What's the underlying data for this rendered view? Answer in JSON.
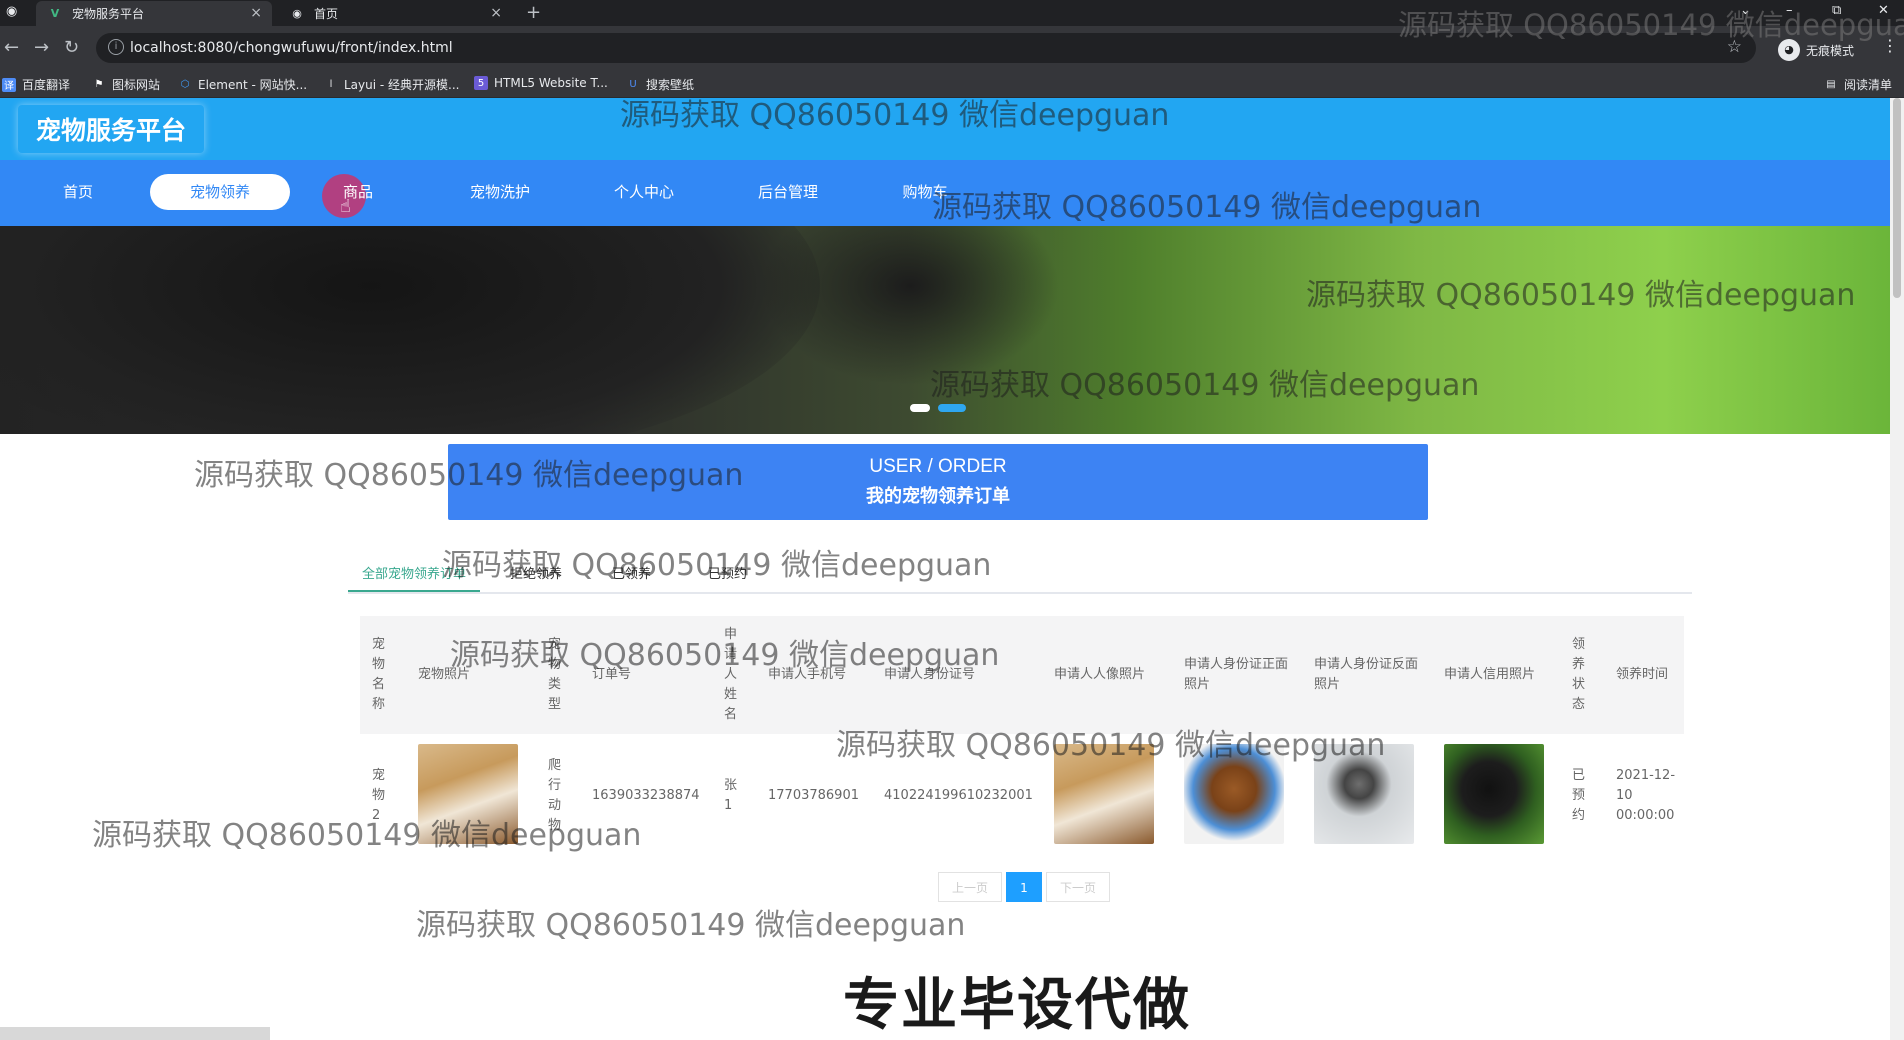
{
  "browser": {
    "tabs": [
      {
        "title": "宠物服务平台",
        "icon": "vue-icon"
      },
      {
        "title": "首页",
        "icon": "globe-icon"
      }
    ],
    "url": "localhost:8080/chongwufuwu/front/index.html",
    "incognito_label": "无痕模式",
    "bookmarks": [
      "百度翻译",
      "图标网站",
      "Element - 网站快...",
      "Layui - 经典开源模...",
      "HTML5 Website T...",
      "搜索壁纸"
    ],
    "reading_list": "阅读清单"
  },
  "site": {
    "logo": "宠物服务平台",
    "nav": [
      "首页",
      "宠物领养",
      "商品",
      "宠物洗护",
      "个人中心",
      "后台管理",
      "购物车"
    ],
    "active_nav": "宠物领养",
    "accent": "#3288f5",
    "header_color": "#22a6f2"
  },
  "section": {
    "title_en": "USER / ORDER",
    "title_cn": "我的宠物领养订单"
  },
  "order_tabs": [
    "全部宠物领养订单",
    "拒绝领养",
    "已领养",
    "已预约"
  ],
  "table": {
    "headers": [
      "宠物名称",
      "宠物照片",
      "宠物类型",
      "订单号",
      "申请人姓名",
      "申请人手机号",
      "申请人身份证号",
      "申请人人像照片",
      "申请人身份证正面照片",
      "申请人身份证反面照片",
      "申请人信用照片",
      "领养状态",
      "领养时间"
    ],
    "rows": [
      {
        "pet_name": "宠物2",
        "pet_type": "爬行动物",
        "order_no": "1639033238874",
        "applicant_name": "张1",
        "phone": "17703786901",
        "id_number": "410224199610232001",
        "status": "已预约",
        "time": "2021-12-10 00:00:00"
      }
    ]
  },
  "pagination": {
    "prev": "上一页",
    "current": "1",
    "next": "下一页"
  },
  "watermark": "源码获取 QQ86050149 微信deepguan",
  "overlay_text": "专业毕设代做"
}
